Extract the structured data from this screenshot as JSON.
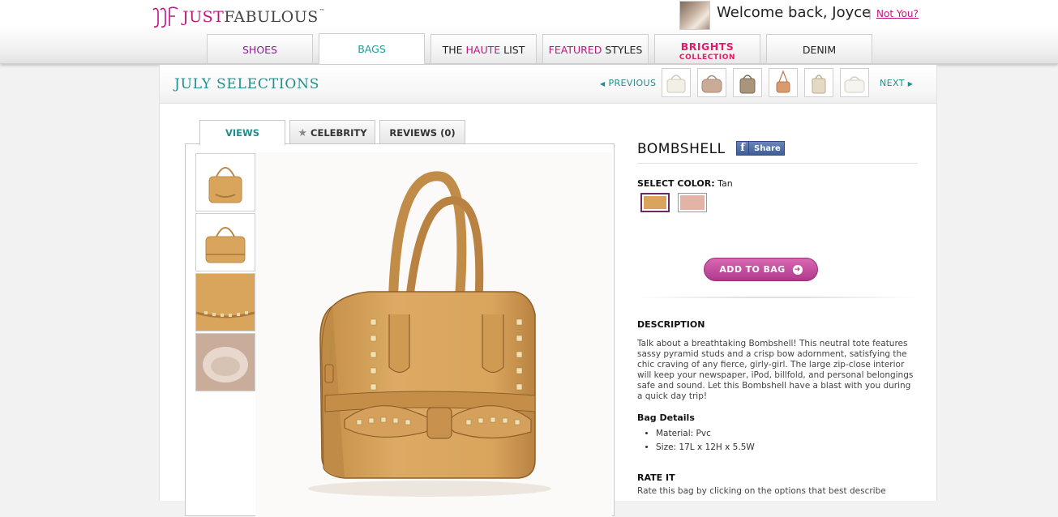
{
  "header": {
    "logo": {
      "just": "JUST",
      "fabulous": "FABULOUS",
      "tm": "™"
    },
    "welcome": "Welcome back, Joyce",
    "separator": "|",
    "not_you": "Not You?"
  },
  "nav": {
    "tabs": [
      {
        "label": "SHOES"
      },
      {
        "label": "BAGS",
        "active": true
      },
      {
        "label_a": "THE ",
        "label_b": "HAUTE",
        "label_c": " LIST"
      },
      {
        "label_a": "FEATURED",
        "label_b": " STYLES"
      },
      {
        "label_a": "BRIGHTS",
        "label_b": "COLLECTION"
      },
      {
        "label": "DENIM"
      }
    ]
  },
  "selections": {
    "title": "JULY SELECTIONS",
    "previous": "PREVIOUS",
    "next": "NEXT",
    "thumb_count": 6
  },
  "viewer": {
    "tabs": [
      {
        "label": "VIEWS",
        "active": true
      },
      {
        "label": "CELEBRITY",
        "icon": "star-icon"
      },
      {
        "label": "REVIEWS (0)"
      }
    ],
    "thumbnail_count": 4
  },
  "product": {
    "name": "BOMBSHELL",
    "share_label": "Share",
    "select_color_label": "SELECT COLOR:",
    "selected_color": "Tan",
    "swatches": [
      {
        "color": "#d9a55d",
        "selected": true
      },
      {
        "color": "#e3b3a5",
        "selected": false
      }
    ],
    "add_to_bag": "ADD TO BAG",
    "description_heading": "DESCRIPTION",
    "description": "Talk about a breathtaking Bombshell! This neutral tote features sassy pyramid studs and a crisp bow adornment, satisfying the chic craving of any fierce, girly-girl. The large zip-close interior will keep your newspaper, iPod, billfold, and personal belongings safe and sound. Let this Bombshell have a blast with you during a quick day trip!",
    "details_heading": "Bag Details",
    "details": [
      "Material: Pvc",
      "Size: 17L x 12H x 5.5W"
    ],
    "rate_heading": "RATE IT",
    "rate_text": "Rate this bag by clicking on the options that best describe"
  },
  "colors": {
    "brand_pink": "#c0147f",
    "teal": "#1f8f8d",
    "bag_tan": "#d9a55d"
  }
}
